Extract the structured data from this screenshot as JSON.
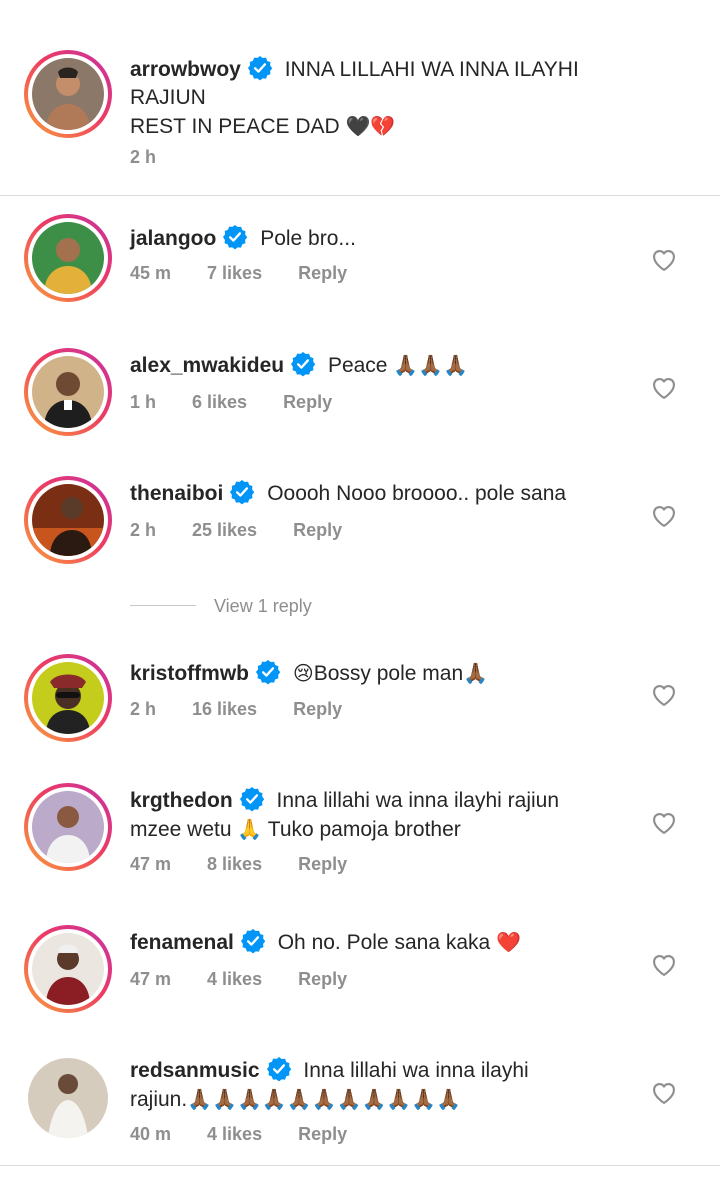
{
  "caption": {
    "username": "arrowbwoy",
    "text_line1": "INNA LILLAHI WA INNA ILAYHI",
    "text_line2": "RAJIUN",
    "text_line3": "REST IN PEACE DAD",
    "emojis": "🖤💔",
    "time": "2 h",
    "avatar_icon": "person-avatar"
  },
  "comments": [
    {
      "username": "jalangoo",
      "text": "Pole bro...",
      "time": "45 m",
      "likes": "7 likes",
      "reply": "Reply",
      "avatar_color": "#2e8b3e"
    },
    {
      "username": "alex_mwakideu",
      "text": "Peace",
      "emoji": "🙏🏾🙏🏾🙏🏾",
      "time": "1 h",
      "likes": "6 likes",
      "reply": "Reply",
      "avatar_color": "#c9a67c"
    },
    {
      "username": "thenaiboi",
      "text": "Ooooh Nooo broooo.. pole sana",
      "time": "2 h",
      "likes": "25 likes",
      "reply": "Reply",
      "avatar_color": "#8a3a1a"
    },
    {
      "username": "kristoffmwb",
      "emoji_prefix": "😢",
      "text": "Bossy pole man",
      "emoji": "🙏🏾",
      "time": "2 h",
      "likes": "16 likes",
      "reply": "Reply",
      "avatar_color": "#c9d21d"
    },
    {
      "username": "krgthedon",
      "text_line1": "Inna lillahi wa inna ilayhi rajiun",
      "text_line2a": "mzee wetu",
      "emoji_mid": "🙏",
      "text_line2b": "Tuko pamoja brother",
      "time": "47 m",
      "likes": "8 likes",
      "reply": "Reply",
      "avatar_color": "#b9a7c9"
    },
    {
      "username": "fenamenal",
      "text": "Oh no. Pole sana kaka",
      "emoji": "❤️",
      "time": "47 m",
      "likes": "4 likes",
      "reply": "Reply",
      "avatar_color": "#e9e4dd"
    },
    {
      "username": "redsanmusic",
      "text_line1": "Inna lillahi wa inna ilayhi",
      "text_line2": "rajiun.",
      "emoji": "🙏🏾🙏🏾🙏🏾🙏🏾🙏🏾🙏🏾🙏🏾🙏🏾🙏🏾🙏🏾🙏🏾",
      "time": "40 m",
      "likes": "4 likes",
      "reply": "Reply",
      "avatar_color": "#d8cfc2"
    }
  ],
  "view_replies": "View 1 reply",
  "colors": {
    "verified": "#0095f6",
    "meta": "#8e8e8e",
    "text": "#262626"
  }
}
